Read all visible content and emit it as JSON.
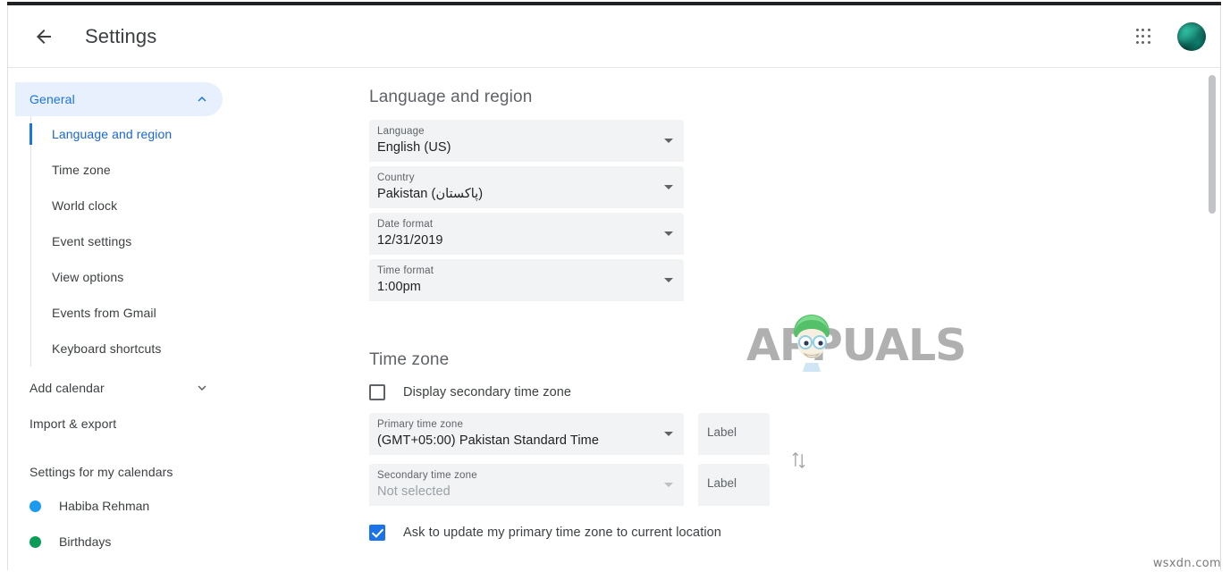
{
  "header": {
    "back_icon": "arrow-left-icon",
    "title": "Settings",
    "apps_icon": "apps-grid-icon",
    "avatar_label": "account-avatar"
  },
  "sidebar": {
    "general": {
      "label": "General",
      "chevron": "chevron-up-icon",
      "items": [
        {
          "label": "Language and region",
          "active": true
        },
        {
          "label": "Time zone",
          "active": false
        },
        {
          "label": "World clock",
          "active": false
        },
        {
          "label": "Event settings",
          "active": false
        },
        {
          "label": "View options",
          "active": false
        },
        {
          "label": "Events from Gmail",
          "active": false
        },
        {
          "label": "Keyboard shortcuts",
          "active": false
        }
      ]
    },
    "add_calendar": {
      "label": "Add calendar",
      "chevron": "chevron-down-icon"
    },
    "import_export": {
      "label": "Import & export"
    },
    "calendars_title": "Settings for my calendars",
    "calendars": [
      {
        "label": "Habiba Rehman",
        "color": "#1a9bf0"
      },
      {
        "label": "Birthdays",
        "color": "#0b9d58"
      }
    ]
  },
  "language_region": {
    "title": "Language and region",
    "fields": [
      {
        "label": "Language",
        "value": "English (US)"
      },
      {
        "label": "Country",
        "value": "Pakistan (پاکستان)"
      },
      {
        "label": "Date format",
        "value": "12/31/2019"
      },
      {
        "label": "Time format",
        "value": "1:00pm"
      }
    ]
  },
  "time_zone": {
    "title": "Time zone",
    "display_secondary": {
      "label": "Display secondary time zone",
      "checked": false
    },
    "primary": {
      "label": "Primary time zone",
      "value": "(GMT+05:00) Pakistan Standard Time",
      "side_label": "Label"
    },
    "secondary": {
      "label": "Secondary time zone",
      "value": "Not selected",
      "side_label": "Label"
    },
    "swap_icon": "swap-vertical-icon",
    "ask_update": {
      "label": "Ask to update my primary time zone to current location",
      "checked": true
    }
  },
  "watermarks": {
    "appuals": "APPUALS",
    "source": "wsxdn.com"
  },
  "colors": {
    "accent": "#1a73e8",
    "accent_bg": "#e8f0fe",
    "field_bg": "#f1f3f4",
    "text": "#3c4043",
    "muted": "#5f6368"
  }
}
